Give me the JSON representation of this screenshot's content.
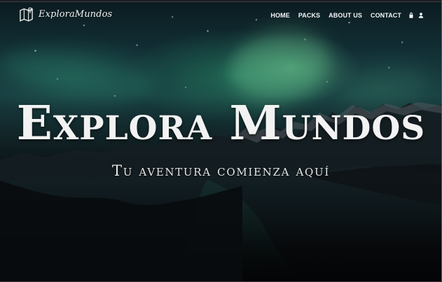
{
  "brand": {
    "name": "ExploraMundos",
    "icon": "map-icon"
  },
  "nav": {
    "items": [
      {
        "label": "HOME"
      },
      {
        "label": "PACKS"
      },
      {
        "label": "ABOUT US"
      },
      {
        "label": "CONTACT"
      }
    ],
    "icons": [
      "shopping-bag-icon",
      "user-icon"
    ]
  },
  "hero": {
    "title": "Explora Mundos",
    "subtitle": "Tu aventura comienza aquí"
  },
  "colors": {
    "text": "#f4f6f7",
    "aurora": "#45d98a",
    "background": "#06080c"
  }
}
